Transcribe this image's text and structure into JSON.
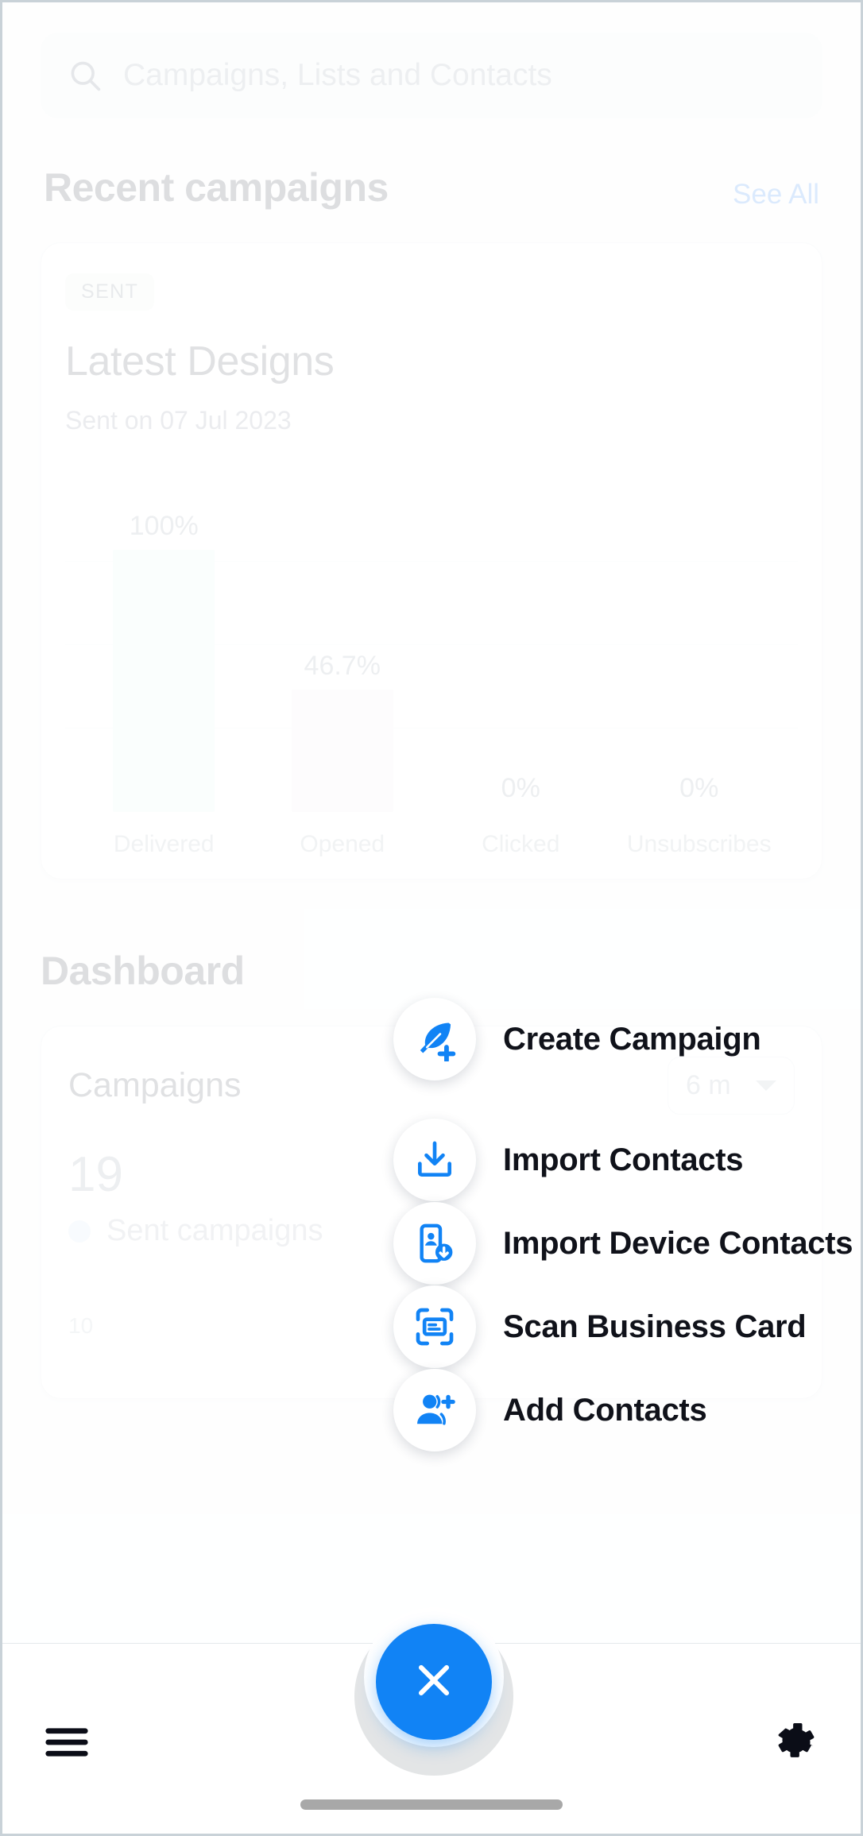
{
  "search": {
    "placeholder": "Campaigns, Lists and Contacts",
    "value": "",
    "icon": "search-icon"
  },
  "recent": {
    "title": "Recent campaigns",
    "see_all": "See All",
    "card": {
      "status": "SENT",
      "name": "Latest Designs",
      "sent_on": "Sent on 07 Jul 2023"
    }
  },
  "chart_data": {
    "type": "bar",
    "title": "Latest Designs",
    "categories": [
      "Delivered",
      "Opened",
      "Clicked",
      "Unsubscribes"
    ],
    "values": [
      100,
      46.7,
      0,
      0
    ],
    "value_labels": [
      "100%",
      "46.7%",
      "0%",
      "0%"
    ],
    "bar_colors": [
      "#e4faf5",
      "#f4f2f9",
      "#f7f8fa",
      "#f7f8fa"
    ],
    "xlabel": "",
    "ylabel": "",
    "ylim": [
      0,
      100
    ],
    "grid": true,
    "legend": "none"
  },
  "dashboard": {
    "title": "Dashboard",
    "campaigns_card": {
      "title": "Campaigns",
      "range_value": "6 m",
      "range_caret": "chevron-down-icon",
      "count": "19",
      "legend_label": "Sent campaigns",
      "legend_color": "#d9ecfb",
      "y_axis_label": "10"
    }
  },
  "speed_dial": {
    "expanded": true,
    "items": [
      {
        "label": "Create Campaign",
        "icon": "feather-plus-icon"
      },
      {
        "label": "Import Contacts",
        "icon": "download-tray-icon"
      },
      {
        "label": "Import Device Contacts",
        "icon": "phone-contact-download-icon"
      },
      {
        "label": "Scan Business Card",
        "icon": "scan-card-icon"
      },
      {
        "label": "Add Contacts",
        "icon": "person-add-icon"
      }
    ],
    "close_label": "Close",
    "close_icon": "close-icon",
    "accent_color": "#1183f5"
  },
  "bottom_nav": {
    "menu_icon": "hamburger-menu-icon",
    "settings_icon": "gear-icon"
  }
}
